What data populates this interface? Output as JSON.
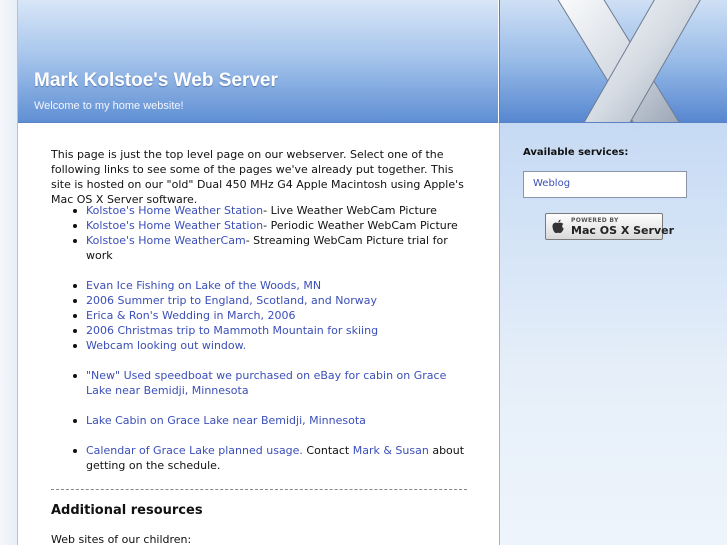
{
  "header": {
    "title": "Mark Kolstoe's Web Server",
    "tagline": "Welcome to my home website!"
  },
  "main": {
    "intro": "This page is just the top level page on our webserver. Select one of the following links to see some of the pages we've already put together. This site is hosted on our \"old\" Dual 450 MHz G4 Apple Macintosh using Apple's Mac OS X Server software.",
    "links": [
      {
        "link": "Kolstoe's Home Weather Station",
        "rest": "- Live Weather WebCam Picture"
      },
      {
        "link": "Kolstoe's Home Weather Station",
        "rest": "- Periodic Weather WebCam Picture"
      },
      {
        "link": "Kolstoe's Home WeatherCam",
        "rest": "- Streaming WebCam Picture trial for work"
      },
      {
        "link": "Evan Ice Fishing on Lake of the Woods, MN",
        "rest": ""
      },
      {
        "link": "2006 Summer trip to England, Scotland, and Norway",
        "rest": ""
      },
      {
        "link": "Erica & Ron's Wedding in March, 2006",
        "rest": ""
      },
      {
        "link": "2006 Christmas trip to Mammoth Mountain for skiing",
        "rest": ""
      },
      {
        "link": "Webcam looking out window.",
        "rest": ""
      },
      {
        "link": "\"New\" Used speedboat we purchased on eBay for cabin on Grace Lake near Bemidji, Minnesota",
        "rest": ""
      },
      {
        "link": "Lake Cabin on Grace Lake near Bemidji, Minnesota",
        "rest": ""
      }
    ],
    "calendar": {
      "link": "Calendar of Grace Lake planned usage.",
      "contact_prefix": " Contact ",
      "contact_link": "Mark & Susan",
      "suffix": " about getting on the schedule."
    },
    "additional_heading": "Additional resources",
    "children_label": "Web sites of our children:"
  },
  "sidebar": {
    "heading": "Available services:",
    "services": [
      "Weblog"
    ],
    "badge": {
      "small": "POWERED BY",
      "big": "Mac OS X Server"
    }
  },
  "colors": {
    "link": "#3b4fb8",
    "header_blue": "#5f8fd4"
  }
}
